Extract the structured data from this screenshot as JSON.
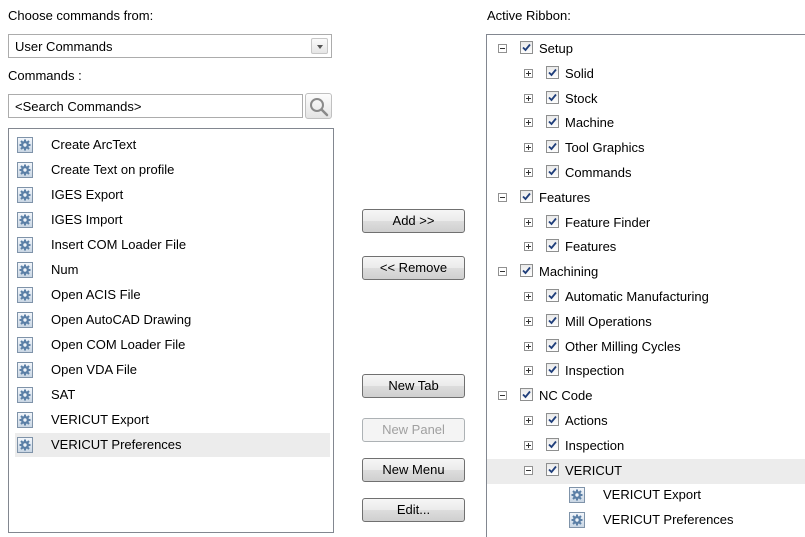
{
  "choose_label": "Choose commands from:",
  "choose_value": "User Commands",
  "commands_label": "Commands :",
  "search_placeholder": "<Search Commands>",
  "commands": [
    "Create ArcText",
    "Create Text on profile",
    "IGES Export",
    "IGES Import",
    "Insert COM Loader File",
    "Num",
    "Open ACIS File",
    "Open AutoCAD Drawing",
    "Open COM Loader File",
    "Open VDA File",
    "SAT",
    "VERICUT Export",
    "VERICUT Preferences"
  ],
  "selected_command": "VERICUT Preferences",
  "buttons": {
    "add": "Add >>",
    "remove": "<< Remove",
    "new_tab": "New Tab",
    "new_panel": "New Panel",
    "new_menu": "New Menu",
    "edit": "Edit..."
  },
  "ribbon_label": "Active Ribbon:",
  "ribbon": [
    {
      "label": "Setup",
      "level": 0,
      "expander": "minus",
      "checked": true
    },
    {
      "label": "Solid",
      "level": 1,
      "expander": "plus",
      "checked": true
    },
    {
      "label": "Stock",
      "level": 1,
      "expander": "plus",
      "checked": true
    },
    {
      "label": "Machine",
      "level": 1,
      "expander": "plus",
      "checked": true
    },
    {
      "label": "Tool Graphics",
      "level": 1,
      "expander": "plus",
      "checked": true
    },
    {
      "label": "Commands",
      "level": 1,
      "expander": "plus",
      "checked": true
    },
    {
      "label": "Features",
      "level": 0,
      "expander": "minus",
      "checked": true
    },
    {
      "label": "Feature Finder",
      "level": 1,
      "expander": "plus",
      "checked": true
    },
    {
      "label": "Features",
      "level": 1,
      "expander": "plus",
      "checked": true
    },
    {
      "label": "Machining",
      "level": 0,
      "expander": "minus",
      "checked": true
    },
    {
      "label": "Automatic Manufacturing",
      "level": 1,
      "expander": "plus",
      "checked": true
    },
    {
      "label": "Mill Operations",
      "level": 1,
      "expander": "plus",
      "checked": true
    },
    {
      "label": "Other Milling Cycles",
      "level": 1,
      "expander": "plus",
      "checked": true
    },
    {
      "label": "Inspection",
      "level": 1,
      "expander": "plus",
      "checked": true
    },
    {
      "label": "NC Code",
      "level": 0,
      "expander": "minus",
      "checked": true
    },
    {
      "label": "Actions",
      "level": 1,
      "expander": "plus",
      "checked": true
    },
    {
      "label": "Inspection",
      "level": 1,
      "expander": "plus",
      "checked": true
    },
    {
      "label": "VERICUT",
      "level": 1,
      "expander": "minus",
      "checked": true,
      "selected": true
    },
    {
      "label": "VERICUT Export",
      "level": 2,
      "command": true
    },
    {
      "label": "VERICUT Preferences",
      "level": 2,
      "command": true
    }
  ]
}
